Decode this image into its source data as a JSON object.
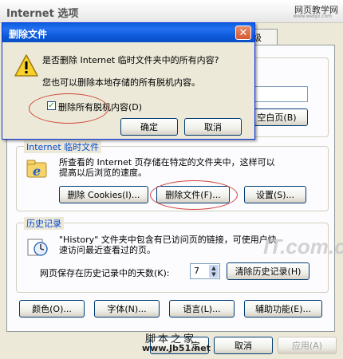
{
  "window": {
    "title": "Internet 选项",
    "watermark_top": "网页教学网",
    "watermark_url": "www.webjx.com",
    "tab_partial": "级"
  },
  "dialog": {
    "title": "删除文件",
    "question": "是否删除 Internet 临时文件夹中的所有内容?",
    "info": "您也可以删除本地存储的所有脱机内容。",
    "checkbox_label": "删除所有脱机内容(D)",
    "checkbox_checked": true,
    "ok_label": "确定",
    "cancel_label": "取消"
  },
  "homepage": {
    "blank_button": "空白页(B)"
  },
  "temp_files": {
    "legend": "Internet 临时文件",
    "description_line1": "所查看的 Internet 页存储在特定的文件夹中，这样可以",
    "description_line2": "提高以后浏览的速度。",
    "delete_cookies": "删除 Cookies(I)...",
    "delete_files": "删除文件(F)...",
    "settings": "设置(S)..."
  },
  "history": {
    "legend": "历史记录",
    "description_line1": "\"History\" 文件夹中包含有已访问页的链接，可使用户快",
    "description_line2": "速访问最近查看过的页。",
    "days_label": "网页保存在历史记录中的天数(K):",
    "days_value": "7",
    "clear_button": "清除历史记录(H)"
  },
  "bottom_buttons": {
    "colors": "颜色(O)...",
    "fonts": "字体(N)...",
    "languages": "语言(L)...",
    "accessibility": "辅助功能(E)..."
  },
  "footer": {
    "ok_partial": "定",
    "cancel": "取消",
    "apply": "应用(A)"
  },
  "watermarks": {
    "itcom": "IT.com.cn",
    "jb51_name": "脚本之家",
    "jb51_url": "www.Jb51.net"
  },
  "colors": {
    "dialog_title": "#0a58d8",
    "annotation": "#d0453a",
    "legend": "#0046d5"
  }
}
